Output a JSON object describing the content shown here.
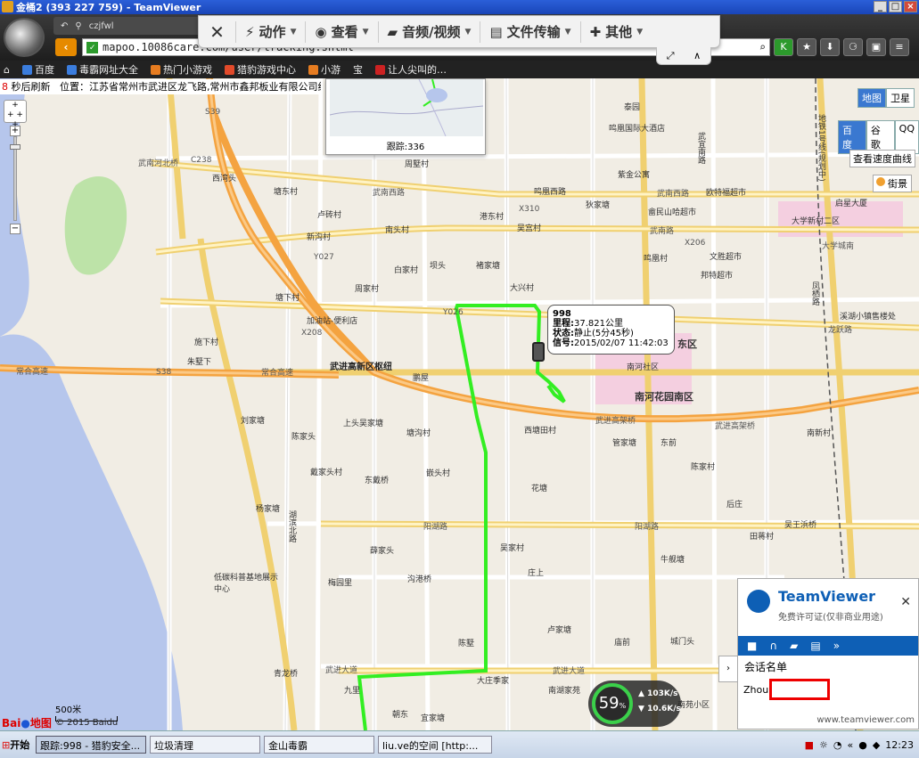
{
  "window": {
    "title": "金桶2 (393 227 759) - TeamViewer"
  },
  "browser": {
    "tab_label": "czjfwl",
    "url": "mapoo.10086care.com/user/tracking.shtml",
    "bookmarks": [
      "百度",
      "毒霸网址大全",
      "热门小游戏",
      "猎豹游戏中心",
      "小游",
      "宝",
      "让人尖叫的…"
    ]
  },
  "teamviewer_toolbar": {
    "items": [
      "动作",
      "查看",
      "音频/视频",
      "文件传输",
      "其他"
    ]
  },
  "status_line": {
    "countdown": "8",
    "refresh_text": "秒后刷新",
    "location": "位置：江苏省常州市武进区龙飞路,常州市鑫邦板业有限公司约59米"
  },
  "map_controls": {
    "map_types": [
      "地图",
      "卫星"
    ],
    "sources": [
      "百度",
      "谷歌",
      "QQ"
    ],
    "speed_curve": "查看速度曲线",
    "street_view": "街景"
  },
  "overview": {
    "caption": "跟踪:336"
  },
  "vehicle_info": {
    "id": "998",
    "mileage_label": "里程:",
    "mileage": "37.821公里",
    "status_label": "状态:",
    "status": "静止(5分45秒)",
    "signal_label": "信号:",
    "signal": "2015/02/07 11:42:03"
  },
  "map_labels": {
    "roads": [
      "武南河北桥",
      "C238",
      "武南西路",
      "武南西路",
      "武南路",
      "Y027",
      "常合高速",
      "常合高速",
      "武进高架桥",
      "武进高架桥",
      "阳湖路",
      "阳湖路",
      "武进大道",
      "武进大道",
      "龙跃路",
      "大学城南",
      "X310",
      "X206",
      "X208",
      "S39",
      "S38",
      "Y026"
    ],
    "places": [
      "西湾头",
      "塘东村",
      "卢砖村",
      "新沟村",
      "南头村",
      "白家村",
      "坝头",
      "港东村",
      "吴宫村",
      "褚家塘",
      "大兴村",
      "周家村",
      "塘下村",
      "施下村",
      "朱墅下",
      "刘家塘",
      "上头吴家塘",
      "塘沟村",
      "陈家头",
      "戴家头村",
      "东戴桥",
      "嵌头村",
      "杨家塘",
      "吴家村",
      "薛家头",
      "沟港桥",
      "庄上",
      "卢家塘",
      "陈墅",
      "庙前",
      "城门头",
      "九里",
      "朝东",
      "宜家塘",
      "大庄季家",
      "西塘田村",
      "管家塘",
      "东前",
      "陈家村",
      "后庄",
      "牛舰塘",
      "南湖家苑",
      "南苑小区",
      "南河社区",
      "南河花园南区",
      "东区",
      "启星大厦",
      "大学新村二区",
      "文胜超市",
      "邦特超市",
      "溪湖小镇售楼处",
      "紫金公寓",
      "欧特福超市",
      "畲民山哈超市",
      "狄家塘",
      "鸣凰村",
      "鸣凰国际大酒店",
      "鸣凰西路",
      "泰园",
      "周墅村",
      "加油站-便利店",
      "武进高新区枢纽",
      "鹏屋",
      "低碳科普基地展示中心",
      "梅园里",
      "青龙桥",
      "吴王浜桥",
      "田蒋村",
      "南新村",
      "湖滨北路",
      "武宜南路",
      "凤栖路",
      "地铁1号线(规划中)",
      "花塘"
    ]
  },
  "scale": {
    "label": "500米"
  },
  "copyright": "© 2015 Baidu",
  "speed_gauge": {
    "percent": "59",
    "unit": "%",
    "up": "103K/s",
    "down": "10.6K/s"
  },
  "tv_panel": {
    "name": "TeamViewer",
    "license": "免费许可证(仅非商业用途)",
    "session_title": "会话名单",
    "session_user": "Zhou (",
    "footer": "www.teamviewer.com"
  },
  "taskbar": {
    "start": "开始",
    "tasks": [
      "跟踪:998 - 猎豹安全...",
      "垃圾清理",
      "金山毒霸",
      "liu.ve的空间 [http:..."
    ],
    "clock": "12:23"
  },
  "colors": {
    "route": "#33ee22",
    "expressway": "#f4a340",
    "highway": "#ffe27a",
    "water": "#b6c6ec",
    "greenland": "#bde3a8"
  }
}
